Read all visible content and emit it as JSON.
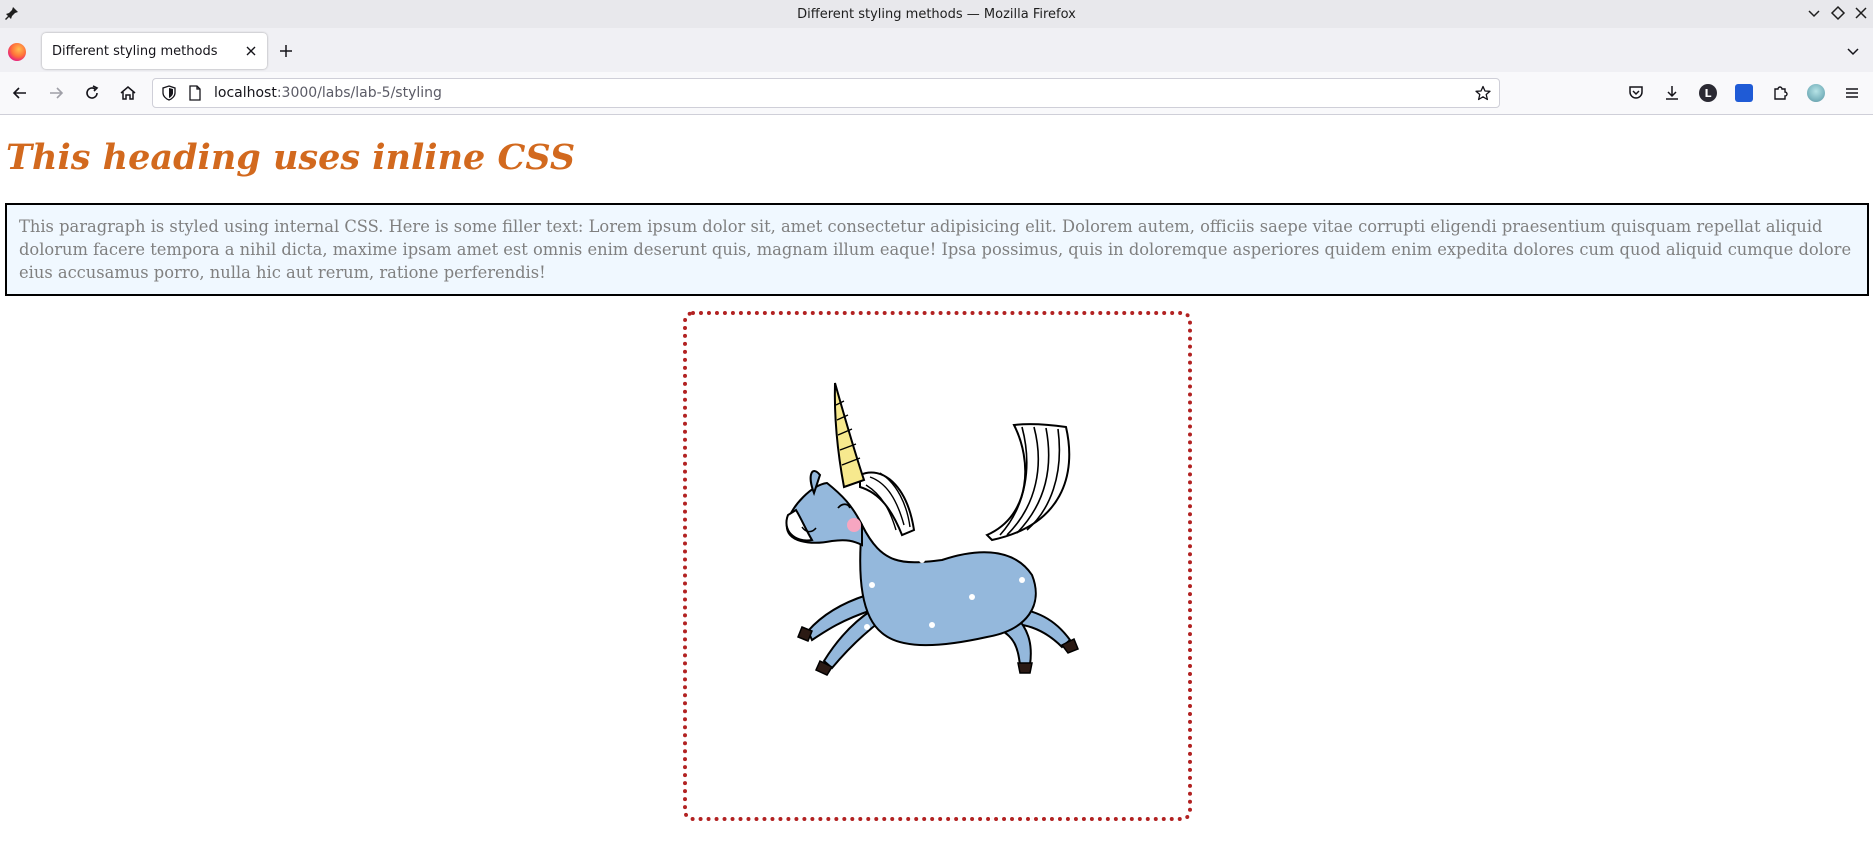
{
  "window": {
    "title": "Different styling methods — Mozilla Firefox"
  },
  "tabs": [
    {
      "title": "Different styling methods",
      "active": true
    }
  ],
  "navbar": {
    "url_host": "localhost",
    "url_path": ":3000/labs/lab-5/styling",
    "account_initial": "L"
  },
  "page": {
    "heading": "This heading uses inline CSS",
    "paragraph": "This paragraph is styled using internal CSS. Here is some filler text: Lorem ipsum dolor sit, amet consectetur adipisicing elit. Dolorem autem, officiis saepe vitae corrupti eligendi praesentium quisquam repellat aliquid dolorum facere tempora a nihil dicta, maxime ipsam amet est omnis enim deserunt quis, magnam illum eaque! Ipsa possimus, quis in doloremque asperiores quidem enim expedita dolores cum quod aliquid cumque dolore eius accusamus porro, nulla hic aut rerum, ratione perferendis!"
  },
  "colors": {
    "heading": "#d2691e",
    "paragraph_text": "#808080",
    "paragraph_bg": "#f0f8ff",
    "image_border": "#b22222",
    "unicorn_body": "#94b8dc",
    "unicorn_horn": "#f7e98e"
  }
}
